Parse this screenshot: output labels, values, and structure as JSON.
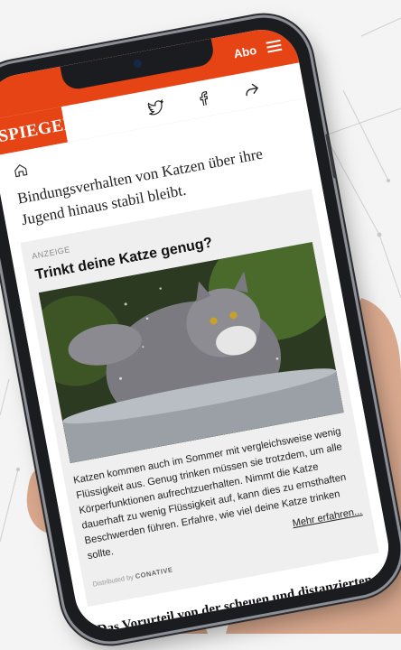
{
  "header": {
    "abo_label": "Abo",
    "logo_text": "SPIEGEL",
    "menu_icon": "hamburger-menu-icon",
    "share_icons": [
      "twitter-icon",
      "facebook-icon",
      "share-arrow-icon"
    ]
  },
  "article": {
    "home_icon": "home-icon",
    "lead_text": "Bindungsverhalten von Katzen über ihre Jugend hinaus stabil bleibt.",
    "next_headline": "Das Vorurteil von der scheuen und distanzierten Katze"
  },
  "ad": {
    "label": "ANZEIGE",
    "title": "Trinkt deine Katze genug?",
    "body": "Katzen kommen auch im Sommer mit vergleichsweise wenig Flüssigkeit aus. Genug trinken müssen sie trotzdem, um alle Körperfunktionen aufrechtzuerhalten. Nimmt die Katze dauerhaft zu wenig Flüssigkeit auf, kann dies zu ernsthaften Beschwerden führen. Erfahre, wie viel deine Katze trinken sollte.",
    "link_text": "Mehr erfahren...",
    "distributed_by": "Distributed by",
    "distributor": "CONATIVE"
  },
  "colors": {
    "brand_red": "#e64415",
    "background": "#f4f4f4",
    "ad_background": "#efefef"
  }
}
